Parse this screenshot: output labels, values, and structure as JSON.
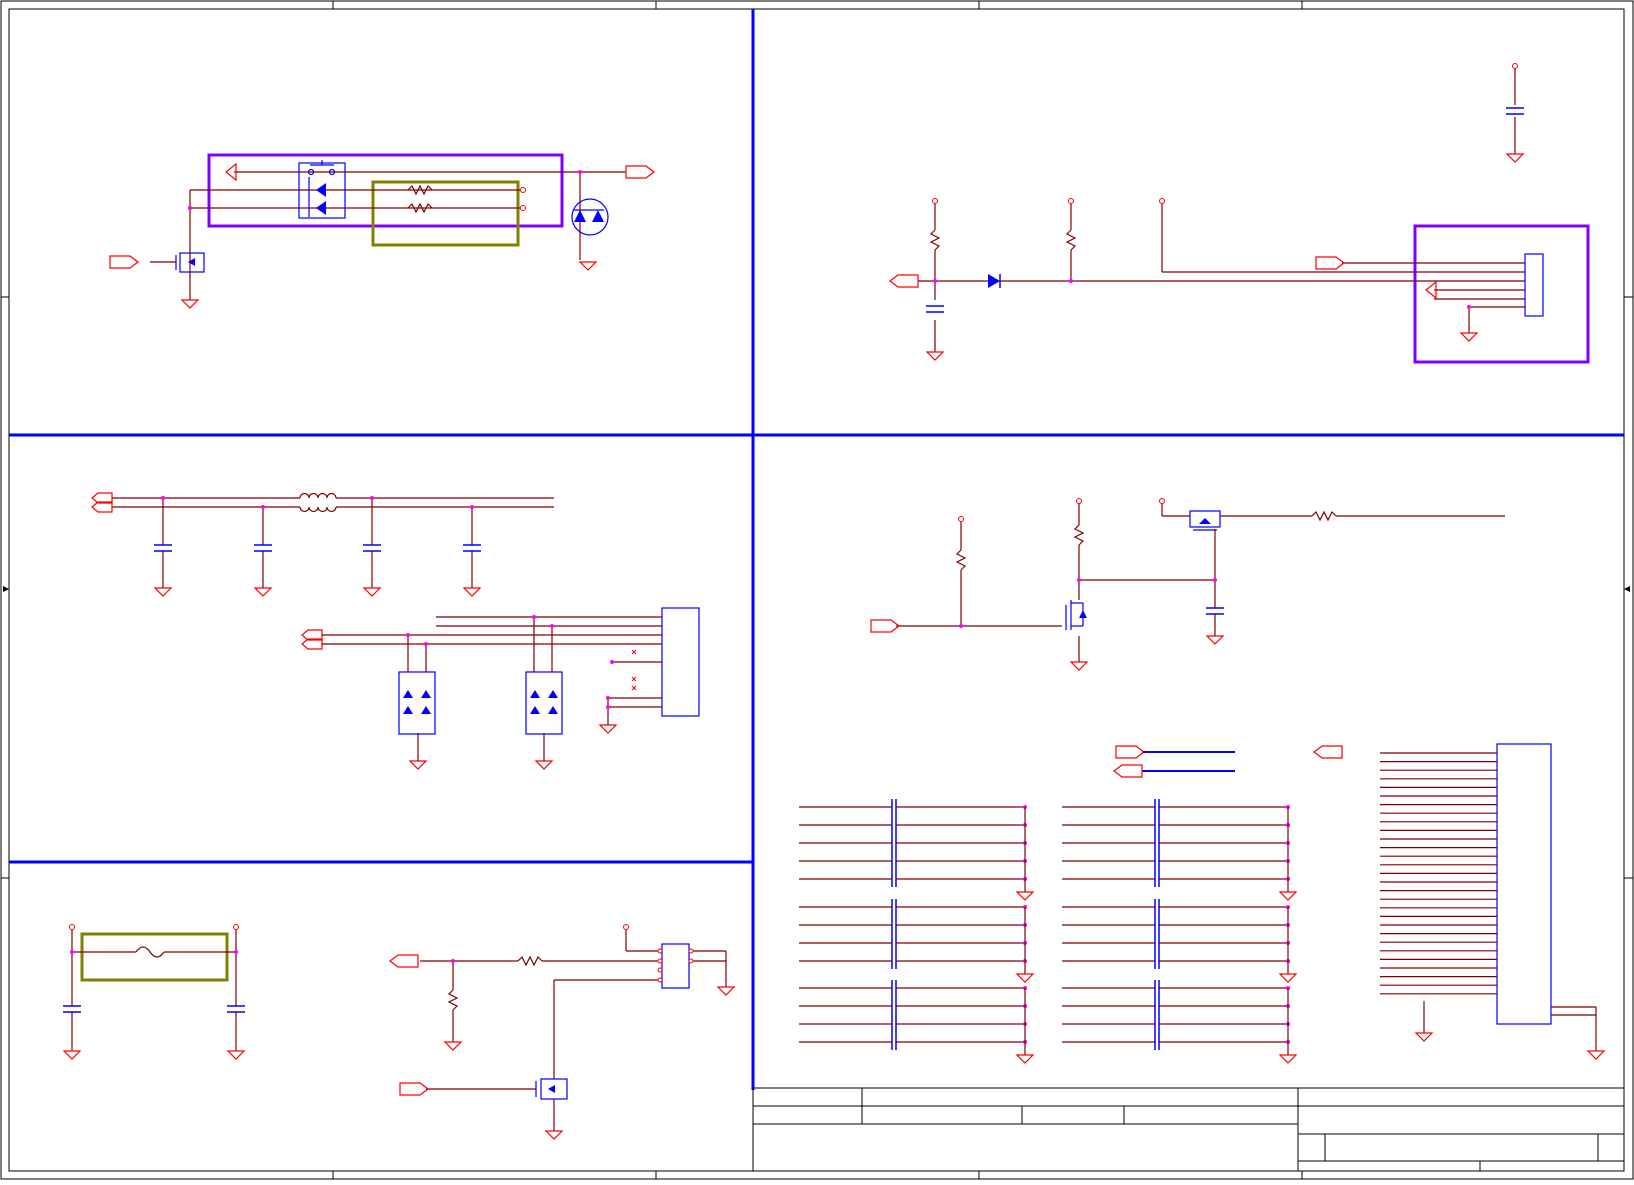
{
  "sheet": {
    "kind": "schematic",
    "border_color": "#000000",
    "section_divider_color": "#0000ff",
    "wire_color": "#800000",
    "net_flag_color": "#ff0000",
    "junction_color": "#ff00ff",
    "component_body_color": "#0000ff",
    "highlight_box_purple": "#8000ff",
    "highlight_box_olive": "#808000",
    "title_block": {
      "rows": 4,
      "text": []
    }
  }
}
